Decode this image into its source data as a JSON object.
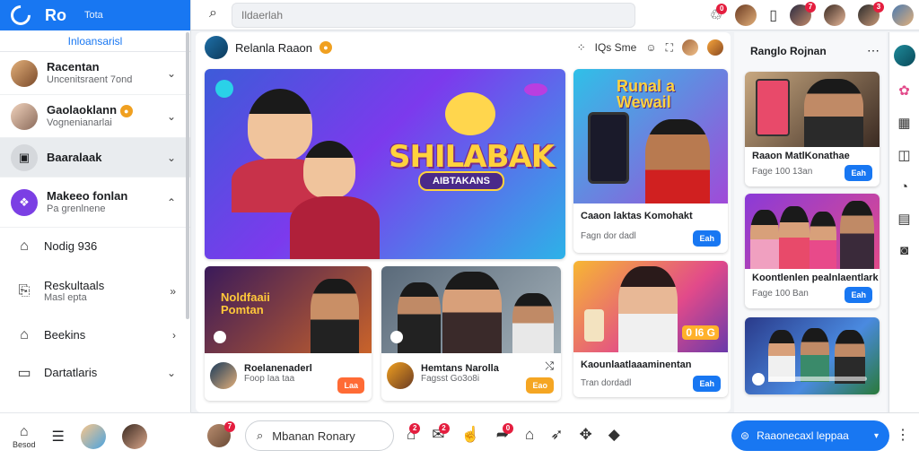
{
  "brand": {
    "name": "Ro",
    "tag": "Tota"
  },
  "sidebar": {
    "section": "Inloansarisl",
    "items": [
      {
        "title": "Racentan",
        "sub": "Uncenitsraent 7ond"
      },
      {
        "title": "Gaolaoklann",
        "sub": "Vognenianarlai"
      },
      {
        "title": "Baaralaak",
        "sub": ""
      },
      {
        "title": "Makeeo fonlan",
        "sub": "Pa grenlnene"
      },
      {
        "title": "Nodig 936",
        "sub": ""
      },
      {
        "title": "Reskultaals",
        "sub": "Masl epta"
      },
      {
        "title": "Beekins",
        "sub": ""
      },
      {
        "title": "Dartatlaris",
        "sub": ""
      }
    ],
    "bottom": {
      "home": "Besod"
    }
  },
  "topbar": {
    "search_placeholder": "Ildaerlah",
    "notif_badge": "0",
    "badges": [
      "7",
      "3"
    ]
  },
  "feed": {
    "header": "Relanla Raaon",
    "tools_label": "Sme",
    "tools_prefix": "IQs",
    "hero": {
      "title": "SHILABAK",
      "subtitle": "AIBTAKANS"
    },
    "cards": [
      {
        "title": "Caaon laktas Komohakt",
        "sub": "Fagn dor dadl",
        "cta": "Eah",
        "art": "Runal a Wewail"
      },
      {
        "title": "Roelanenaderl",
        "sub": "Foop Iaa taa",
        "cta": "Laa",
        "art": "Noldfaaii Pomtan"
      },
      {
        "title": "Hemtans Narolla",
        "sub": "Fagsst Go3o8i",
        "cta": "Eao"
      },
      {
        "title": "Kaounlaatlaaaminentan",
        "sub": "Tran dordadl",
        "cta": "Eah",
        "art": "0 I6 G"
      }
    ]
  },
  "rcol": {
    "title": "Ranglo Rojnan",
    "items": [
      {
        "title": "Raaon MatlKonathae",
        "sub": "Fage 100 13an",
        "cta": "Eah"
      },
      {
        "title": "Koontlenlen pealnlaentlark",
        "sub": "Fage 100 Ban",
        "cta": "Eah"
      },
      {
        "title": "",
        "sub": "",
        "cta": ""
      }
    ]
  },
  "bottombar": {
    "search_label": "Mbanan Ronary",
    "cta_label": "Raaonecaxl leppaa",
    "badges": [
      "7",
      "2",
      "2"
    ]
  },
  "colors": {
    "primary": "#1877f2",
    "badge": "#e41e3f",
    "cta_orange": "#ff6b35",
    "cta_gold": "#f5a623"
  }
}
